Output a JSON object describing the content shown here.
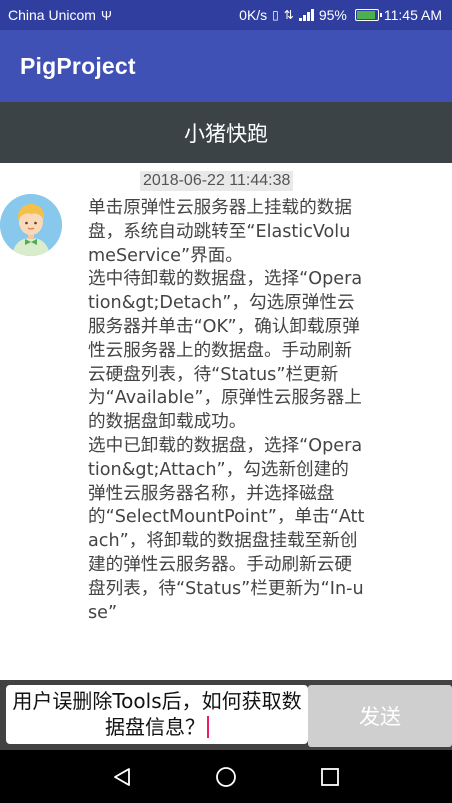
{
  "status_bar": {
    "carrier": "China Unicom",
    "network_speed": "0K/s",
    "battery_percent": "95%",
    "time": "11:45 AM",
    "icons": [
      "usb-icon",
      "vibrate-icon",
      "data-icon",
      "signal-icon",
      "battery-icon"
    ]
  },
  "app_bar": {
    "title": "PigProject"
  },
  "chat": {
    "title": "小猪快跑",
    "messages": [
      {
        "timestamp": "2018-06-22  11:44:38",
        "sender_avatar": "boy-avatar-icon",
        "text": "单击原弹性云服务器上挂载的数据盘，系统自动跳转至“ElasticVolumeService”界面。\n选中待卸载的数据盘，选择“Operation&gt;Detach”，勾选原弹性云服务器并单击“OK”，确认卸载原弹性云服务器上的数据盘。手动刷新云硬盘列表，待“Status”栏更新为“Available”，原弹性云服务器上的数据盘卸载成功。\n选中已卸载的数据盘，选择“Operation&gt;Attach”，勾选新创建的弹性云服务器名称，并选择磁盘的“SelectMountPoint”，单击“Attach”，将卸载的数据盘挂载至新创建的弹性云服务器。手动刷新云硬盘列表，待“Status”栏更新为“In-use”"
      }
    ]
  },
  "input": {
    "value": "用户误删除Tools后，如何获取数据盘信息？",
    "send_label": "发送"
  },
  "nav_bar": {
    "buttons": [
      "back-icon",
      "home-icon",
      "recents-icon"
    ]
  },
  "colors": {
    "status_bar": "#303f9f",
    "app_bar": "#3f51b5",
    "chat_header": "#3b4347",
    "input_bar": "#424242",
    "send_button": "#cfcfcf"
  }
}
